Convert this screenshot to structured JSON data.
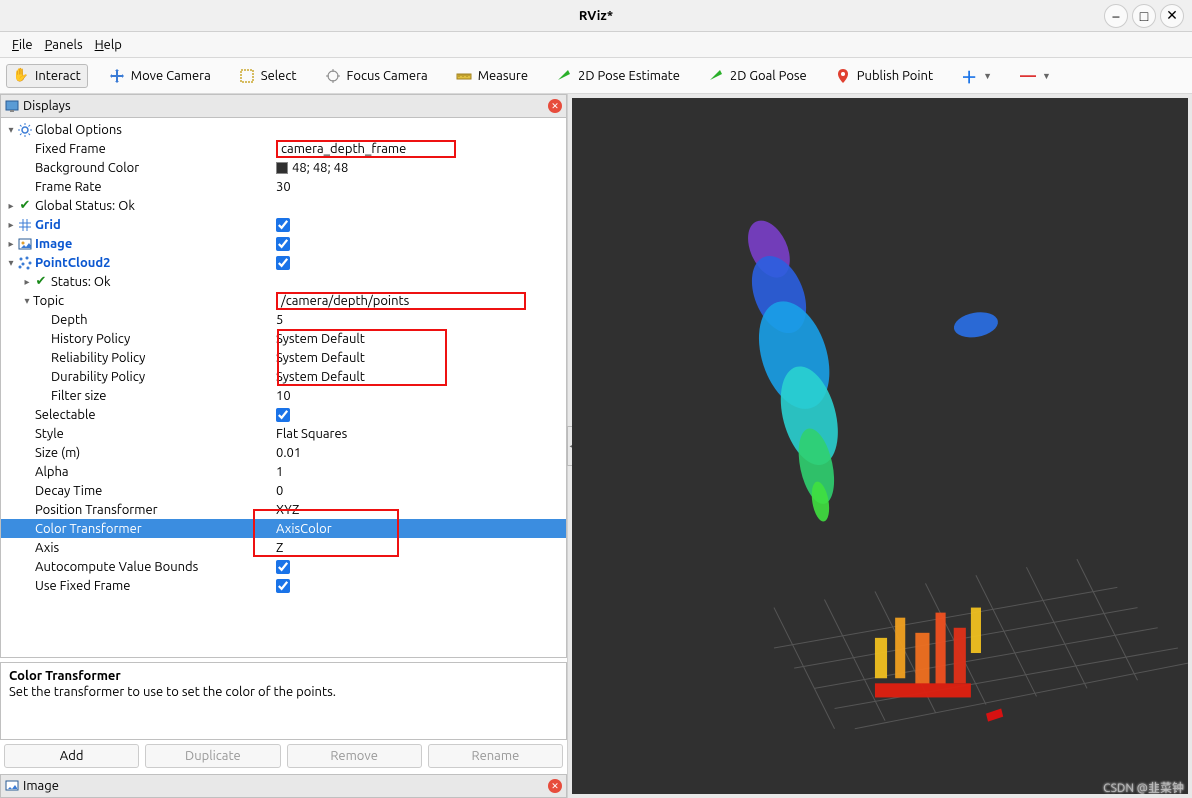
{
  "window": {
    "title": "RViz*"
  },
  "menu": {
    "file": "File",
    "panels": "Panels",
    "help": "Help"
  },
  "toolbar": {
    "interact": "Interact",
    "move_camera": "Move Camera",
    "select": "Select",
    "focus_camera": "Focus Camera",
    "measure": "Measure",
    "pose_estimate": "2D Pose Estimate",
    "goal_pose": "2D Goal Pose",
    "publish_point": "Publish Point"
  },
  "displays_panel": {
    "title": "Displays"
  },
  "image_panel": {
    "title": "Image"
  },
  "tree": {
    "global_options": {
      "label": "Global Options"
    },
    "fixed_frame": {
      "label": "Fixed Frame",
      "value": "camera_depth_frame"
    },
    "background_color": {
      "label": "Background Color",
      "value": "48; 48; 48"
    },
    "frame_rate": {
      "label": "Frame Rate",
      "value": "30"
    },
    "global_status": {
      "label": "Global Status: Ok"
    },
    "grid": {
      "label": "Grid",
      "checked": true
    },
    "image": {
      "label": "Image",
      "checked": true
    },
    "pointcloud2": {
      "label": "PointCloud2",
      "checked": true
    },
    "status_ok": {
      "label": "Status: Ok"
    },
    "topic": {
      "label": "Topic",
      "value": "/camera/depth/points"
    },
    "depth": {
      "label": "Depth",
      "value": "5"
    },
    "history_policy": {
      "label": "History Policy",
      "value": "System Default"
    },
    "reliability_policy": {
      "label": "Reliability Policy",
      "value": "System Default"
    },
    "durability_policy": {
      "label": "Durability Policy",
      "value": "System Default"
    },
    "filter_size": {
      "label": "Filter size",
      "value": "10"
    },
    "selectable": {
      "label": "Selectable",
      "checked": true
    },
    "style": {
      "label": "Style",
      "value": "Flat Squares"
    },
    "size": {
      "label": "Size (m)",
      "value": "0.01"
    },
    "alpha": {
      "label": "Alpha",
      "value": "1"
    },
    "decay_time": {
      "label": "Decay Time",
      "value": "0"
    },
    "position_transformer": {
      "label": "Position Transformer",
      "value": "XYZ"
    },
    "color_transformer": {
      "label": "Color Transformer",
      "value": "AxisColor"
    },
    "axis": {
      "label": "Axis",
      "value": "Z"
    },
    "autocompute_bounds": {
      "label": "Autocompute Value Bounds",
      "checked": true
    },
    "use_fixed_frame": {
      "label": "Use Fixed Frame",
      "checked": true
    }
  },
  "description": {
    "title": "Color Transformer",
    "body": "Set the transformer to use to set the color of the points."
  },
  "buttons": {
    "add": "Add",
    "duplicate": "Duplicate",
    "remove": "Remove",
    "rename": "Rename"
  },
  "watermark": "CSDN @韭菜钟"
}
